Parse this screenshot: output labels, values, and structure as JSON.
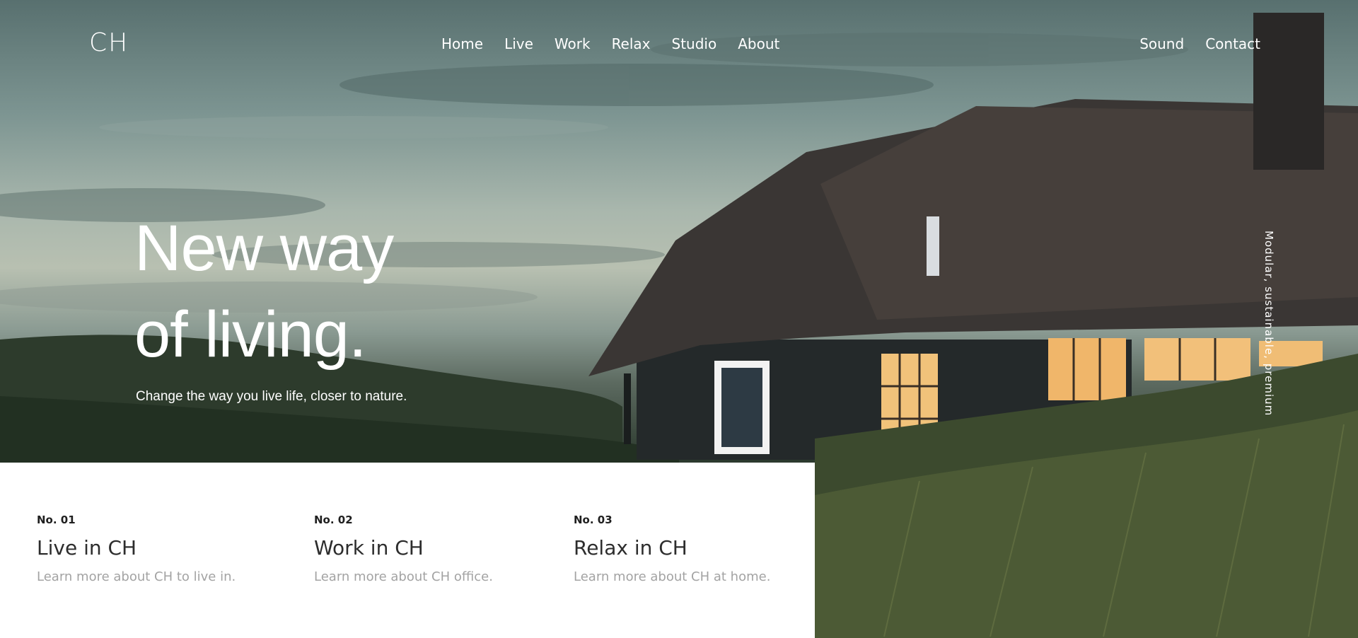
{
  "brand": {
    "logo": "CH"
  },
  "nav": {
    "main": [
      "Home",
      "Live",
      "Work",
      "Relax",
      "Studio",
      "About"
    ],
    "right": [
      "Sound",
      "Contact"
    ]
  },
  "hero": {
    "headline_line1": "New way",
    "headline_line2": "of living.",
    "subline": "Change the way you live life, closer to nature.",
    "vertical_tag": "Modular, sustainable, premium"
  },
  "features": [
    {
      "number": "No. 01",
      "title": "Live in CH",
      "description": "Learn more about CH to live in."
    },
    {
      "number": "No. 02",
      "title": "Work in CH",
      "description": "Learn more about CH office."
    },
    {
      "number": "No. 03",
      "title": "Relax in CH",
      "description": "Learn more about CH at home."
    }
  ],
  "colors": {
    "text_on_hero": "#ffffff",
    "card_background": "#ffffff",
    "feature_title": "#2d2d2d",
    "feature_description": "#a3a3a3"
  }
}
